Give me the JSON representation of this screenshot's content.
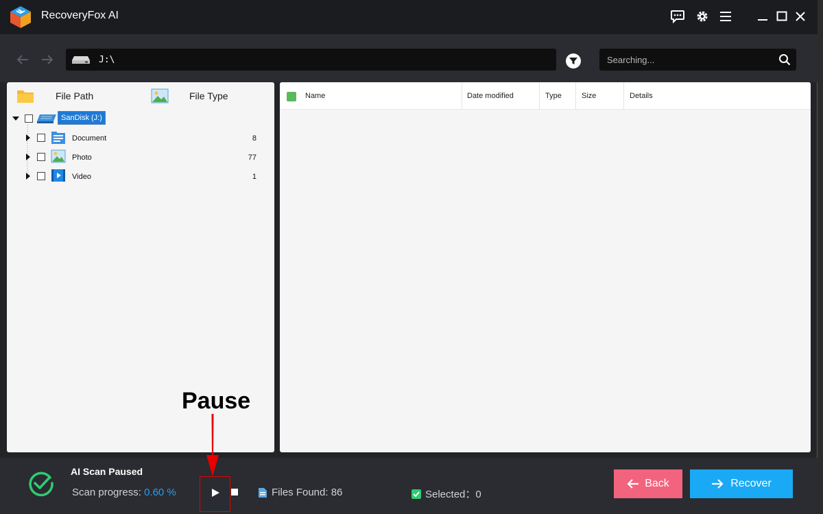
{
  "app": {
    "title": "RecoveryFox AI"
  },
  "toolbar": {
    "path": "J:\\",
    "search_placeholder": "Searching..."
  },
  "left_panel": {
    "tabs": [
      {
        "label": "File Path"
      },
      {
        "label": "File Type"
      }
    ],
    "drive": {
      "label": "SanDisk (J:)"
    },
    "items": [
      {
        "label": "Document",
        "count": "8"
      },
      {
        "label": "Photo",
        "count": "77"
      },
      {
        "label": "Video",
        "count": "1"
      }
    ]
  },
  "file_list": {
    "columns": [
      "Name",
      "Date modified",
      "Type",
      "Size",
      "Details"
    ]
  },
  "status": {
    "title": "AI Scan Paused",
    "progress_label": "Scan progress:",
    "progress_value": "0.60 %",
    "files_found": "Files Found: 86",
    "selected": "Selected：0"
  },
  "buttons": {
    "back": "Back",
    "recover": "Recover"
  },
  "annotation": {
    "label": "Pause"
  },
  "colors": {
    "accent_blue": "#1aa9f5",
    "back_pink": "#f2637e",
    "progress_blue": "#2a9cf0",
    "check_green": "#2ecc71"
  }
}
